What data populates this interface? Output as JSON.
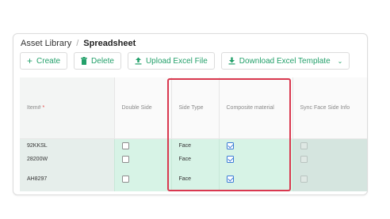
{
  "breadcrumb": {
    "parent": "Asset Library",
    "separator": "/",
    "current": "Spreadsheet"
  },
  "toolbar": {
    "create_label": "Create",
    "delete_label": "Delete",
    "upload_label": "Upload Excel File",
    "download_label": "Download Excel Template"
  },
  "table": {
    "headers": {
      "item": "Item#",
      "required_mark": "*",
      "double_side": "Double Side",
      "side_type": "Side Type",
      "composite": "Composite material",
      "sync": "Sync Face Side Info"
    },
    "rows": [
      {
        "item": "92KKSL",
        "double_side": false,
        "side_type": "Face",
        "composite": true,
        "sync": false
      },
      {
        "item": "28200W",
        "double_side": false,
        "side_type": "Face",
        "composite": true,
        "sync": false
      },
      {
        "item": "AH8297",
        "double_side": false,
        "side_type": "Face",
        "composite": true,
        "sync": false
      }
    ]
  },
  "colors": {
    "accent": "#23a06a",
    "row_bg": "#d7f3e6",
    "highlight": "#d9384f",
    "checkbox_checked": "#3a7bd5"
  }
}
